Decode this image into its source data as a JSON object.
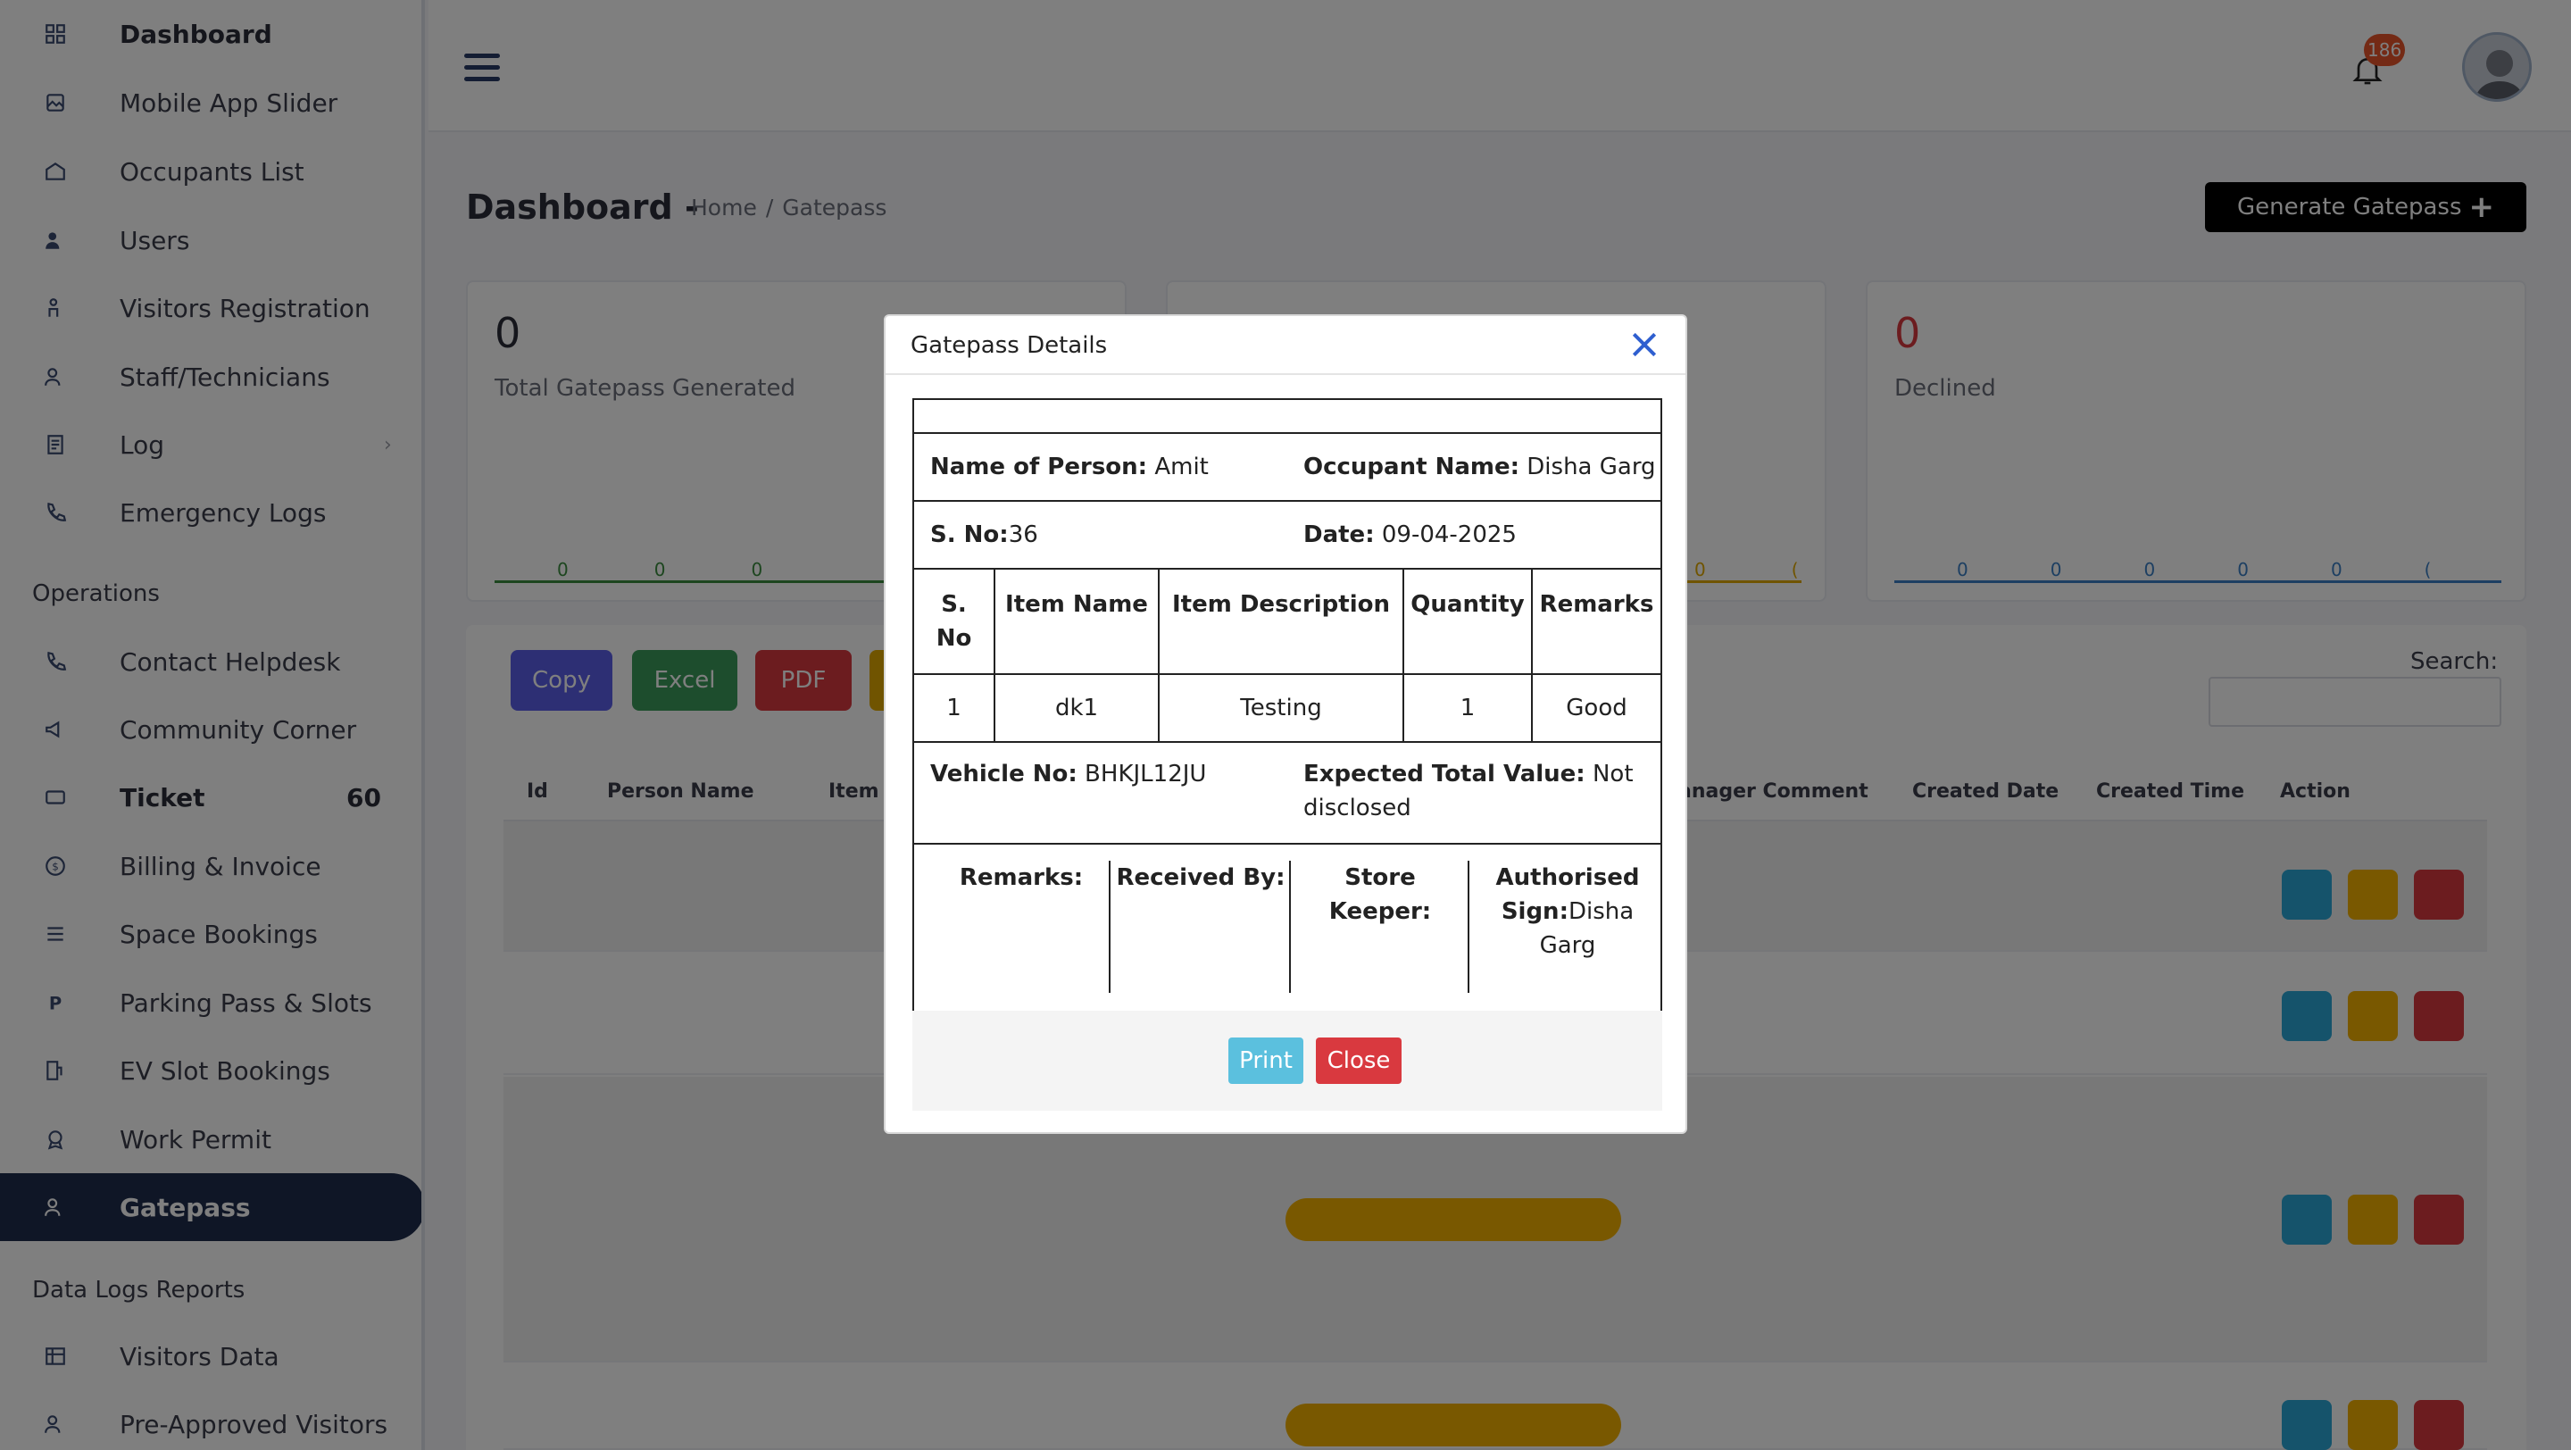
{
  "sidebar": {
    "items": [
      {
        "label": "Dashboard",
        "icon": "dashboard-icon"
      },
      {
        "label": "Mobile App Slider",
        "icon": "slider-icon"
      },
      {
        "label": "Occupants List",
        "icon": "occupants-icon"
      },
      {
        "label": "Users",
        "icon": "users-icon"
      },
      {
        "label": "Visitors Registration",
        "icon": "visitor-icon"
      },
      {
        "label": "Staff/Technicians",
        "icon": "staff-icon"
      },
      {
        "label": "Log",
        "icon": "log-icon"
      },
      {
        "label": "Emergency Logs",
        "icon": "phone-icon"
      }
    ],
    "section_operations": "Operations",
    "operations": [
      {
        "label": "Contact Helpdesk",
        "icon": "phone-icon"
      },
      {
        "label": "Community Corner",
        "icon": "megaphone-icon"
      },
      {
        "label": "Ticket",
        "icon": "ticket-icon",
        "count": "60"
      },
      {
        "label": "Billing & Invoice",
        "icon": "billing-icon"
      },
      {
        "label": "Space Bookings",
        "icon": "space-icon"
      },
      {
        "label": "Parking Pass & Slots",
        "icon": "parking-icon"
      },
      {
        "label": "EV Slot Bookings",
        "icon": "ev-icon"
      },
      {
        "label": "Work Permit",
        "icon": "permit-icon"
      },
      {
        "label": "Gatepass",
        "icon": "gatepass-icon"
      }
    ],
    "section_reports": "Data Logs Reports",
    "reports": [
      {
        "label": "Visitors Data",
        "icon": "table-icon"
      },
      {
        "label": "Pre-Approved Visitors",
        "icon": "user-check-icon"
      }
    ]
  },
  "topbar": {
    "notification_count": "186"
  },
  "header": {
    "title": "Dashboard -",
    "breadcrumb_home": "Home",
    "breadcrumb_sep": "/",
    "breadcrumb_current": "Gatepass",
    "generate_button": "Generate Gatepass"
  },
  "cards": [
    {
      "value": "0",
      "caption": "Total Gatepass Generated",
      "color": "#3a8c3f"
    },
    {
      "value": "",
      "caption": "",
      "color": "#e0a800"
    },
    {
      "value": "0",
      "caption": "Declined",
      "color": "#3a7fc4"
    }
  ],
  "card_zero": "0",
  "table": {
    "buttons": [
      "Copy",
      "Excel",
      "PDF"
    ],
    "button_colors": [
      "#5b5fe8",
      "#3a9a5a",
      "#d9393f"
    ],
    "search_label": "Search:",
    "headers": [
      "Id",
      "Person Name",
      "Item",
      "anager Comment",
      "Created Date",
      "Created Time",
      "Action"
    ]
  },
  "modal": {
    "title": "Gatepass Details",
    "name_label": "Name of Person:",
    "name_value": " Amit",
    "occupant_label": "Occupant Name:",
    "occupant_value": " Disha Garg",
    "sno_label": "S. No:",
    "sno_value": "36",
    "date_label": "Date:",
    "date_value": " 09-04-2025",
    "item_headers": [
      "S. No",
      "Item Name",
      "Item Description",
      "Quantity",
      "Remarks"
    ],
    "items": [
      {
        "sno": "1",
        "name": "dk1",
        "description": "Testing",
        "quantity": "1",
        "remarks": "Good"
      }
    ],
    "vehicle_label": "Vehicle No:",
    "vehicle_value": " BHKJL12JU",
    "expected_label": "Expected Total Value:",
    "expected_value": " Not disclosed",
    "sign_remarks": "Remarks:",
    "sign_received": "Received By:",
    "sign_store": "Store Keeper:",
    "sign_auth_label": "Authorised Sign:",
    "sign_auth_value": "Disha Garg",
    "print_button": "Print",
    "close_button": "Close"
  }
}
